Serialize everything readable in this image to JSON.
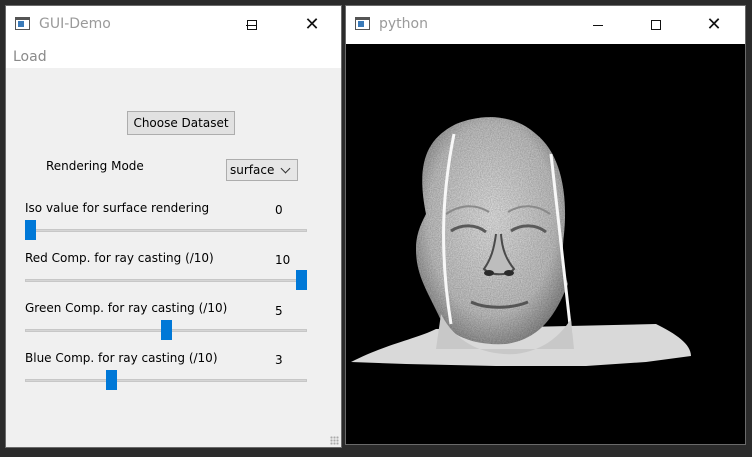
{
  "gui_window": {
    "title": "GUI-Demo",
    "menu": [
      "Load"
    ],
    "choose_dataset_label": "Choose Dataset",
    "rendering_mode": {
      "label": "Rendering Mode",
      "selected": "surface"
    },
    "sliders": [
      {
        "label": "Iso value for surface rendering",
        "value": "0",
        "fraction": 0.0
      },
      {
        "label": "Red Comp. for ray casting (/10)",
        "value": "10",
        "fraction": 1.0
      },
      {
        "label": "Green Comp. for ray casting (/10)",
        "value": "5",
        "fraction": 0.5
      },
      {
        "label": "Blue Comp. for ray casting (/10)",
        "value": "3",
        "fraction": 0.3
      }
    ],
    "accent_color": "#0078d7"
  },
  "render_window": {
    "title": "python"
  }
}
